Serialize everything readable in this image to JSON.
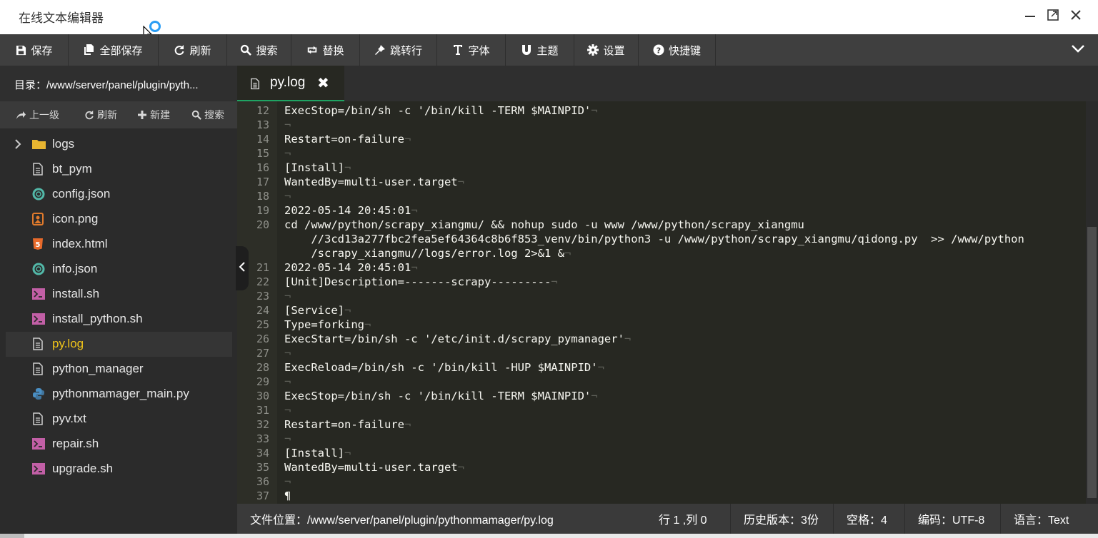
{
  "window": {
    "title": "在线文本编辑器",
    "controls": [
      "minimize",
      "maximize",
      "close"
    ]
  },
  "toolbar": {
    "buttons": [
      {
        "label": "保存",
        "icon": "save-icon"
      },
      {
        "label": "全部保存",
        "icon": "save-all-icon"
      },
      {
        "label": "刷新",
        "icon": "refresh-icon"
      },
      {
        "label": "搜索",
        "icon": "search-icon"
      },
      {
        "label": "替换",
        "icon": "replace-icon"
      },
      {
        "label": "跳转行",
        "icon": "jump-icon"
      },
      {
        "label": "字体",
        "icon": "font-icon"
      },
      {
        "label": "主题",
        "icon": "magnet-icon"
      },
      {
        "label": "设置",
        "icon": "gear-icon"
      },
      {
        "label": "快捷键",
        "icon": "help-icon"
      }
    ]
  },
  "sidebar": {
    "directory": "目录：/www/server/panel/plugin/pyth...",
    "actions": [
      {
        "label": "上一级",
        "icon": "up-level-icon"
      },
      {
        "label": "刷新",
        "icon": "refresh-icon"
      },
      {
        "label": "新建",
        "icon": "plus-icon"
      },
      {
        "label": "搜索",
        "icon": "search-icon"
      }
    ],
    "files": [
      {
        "name": "logs",
        "type": "folder"
      },
      {
        "name": "bt_pym",
        "type": "file"
      },
      {
        "name": "config.json",
        "type": "json"
      },
      {
        "name": "icon.png",
        "type": "image"
      },
      {
        "name": "index.html",
        "type": "html"
      },
      {
        "name": "info.json",
        "type": "json"
      },
      {
        "name": "install.sh",
        "type": "shell"
      },
      {
        "name": "install_python.sh",
        "type": "shell"
      },
      {
        "name": "py.log",
        "type": "file",
        "active": true
      },
      {
        "name": "python_manager",
        "type": "file"
      },
      {
        "name": "pythonmamager_main.py",
        "type": "python"
      },
      {
        "name": "pyv.txt",
        "type": "file"
      },
      {
        "name": "repair.sh",
        "type": "shell"
      },
      {
        "name": "upgrade.sh",
        "type": "shell"
      }
    ]
  },
  "editor": {
    "tab": {
      "label": "py.log",
      "close": "✖"
    },
    "lines": [
      {
        "n": "12",
        "rows": [
          "ExecStop=/bin/sh -c '/bin/kill -TERM $MAINPID'"
        ]
      },
      {
        "n": "13",
        "rows": [
          ""
        ]
      },
      {
        "n": "14",
        "rows": [
          "Restart=on-failure"
        ]
      },
      {
        "n": "15",
        "rows": [
          ""
        ]
      },
      {
        "n": "16",
        "rows": [
          "[Install]"
        ]
      },
      {
        "n": "17",
        "rows": [
          "WantedBy=multi-user.target"
        ]
      },
      {
        "n": "18",
        "rows": [
          ""
        ]
      },
      {
        "n": "19",
        "rows": [
          "2022-05-14 20:45:01"
        ]
      },
      {
        "n": "20",
        "rows": [
          "cd /www/python/scrapy_xiangmu/ && nohup sudo -u www /www/python/scrapy_xiangmu",
          "    //3cd13a277fbc2fea5ef64364c8b6f853_venv/bin/python3 -u /www/python/scrapy_xiangmu/qidong.py  >> /www/python",
          "    /scrapy_xiangmu//logs/error.log 2>&1 &"
        ]
      },
      {
        "n": "21",
        "rows": [
          "2022-05-14 20:45:01"
        ]
      },
      {
        "n": "22",
        "rows": [
          "[Unit]Description=-------scrapy---------"
        ]
      },
      {
        "n": "23",
        "rows": [
          ""
        ]
      },
      {
        "n": "24",
        "rows": [
          "[Service]"
        ]
      },
      {
        "n": "25",
        "rows": [
          "Type=forking"
        ]
      },
      {
        "n": "26",
        "rows": [
          "ExecStart=/bin/sh -c '/etc/init.d/scrapy_pymanager'"
        ]
      },
      {
        "n": "27",
        "rows": [
          ""
        ]
      },
      {
        "n": "28",
        "rows": [
          "ExecReload=/bin/sh -c '/bin/kill -HUP $MAINPID'"
        ]
      },
      {
        "n": "29",
        "rows": [
          ""
        ]
      },
      {
        "n": "30",
        "rows": [
          "ExecStop=/bin/sh -c '/bin/kill -TERM $MAINPID'"
        ]
      },
      {
        "n": "31",
        "rows": [
          ""
        ]
      },
      {
        "n": "32",
        "rows": [
          "Restart=on-failure"
        ]
      },
      {
        "n": "33",
        "rows": [
          ""
        ]
      },
      {
        "n": "34",
        "rows": [
          "[Install]"
        ]
      },
      {
        "n": "35",
        "rows": [
          "WantedBy=multi-user.target"
        ]
      },
      {
        "n": "36",
        "rows": [
          ""
        ]
      },
      {
        "n": "37",
        "rows": [
          "¶"
        ]
      }
    ]
  },
  "status": {
    "path": "文件位置：/www/server/panel/plugin/pythonmamager/py.log",
    "position": "行 1 ,列 0",
    "history": "历史版本：3份",
    "indent": "空格：4",
    "encoding": "编码：UTF-8",
    "language": "语言：Text"
  },
  "colors": {
    "accent": "#1fa463",
    "active_file": "#f0c419",
    "editor_bg": "#272822",
    "toolbar_bg": "#3f3f3f"
  }
}
